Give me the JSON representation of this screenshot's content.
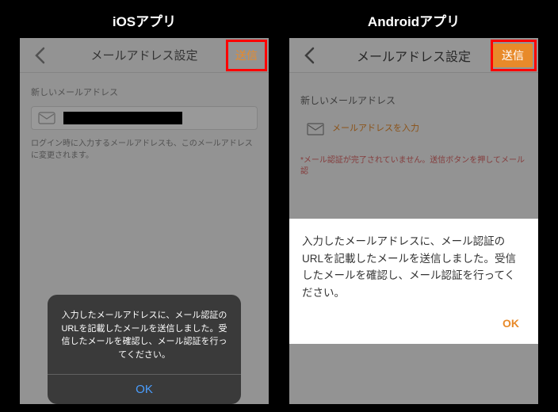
{
  "ios": {
    "label": "iOSアプリ",
    "header_title": "メールアドレス設定",
    "send_label": "送信",
    "field_label": "新しいメールアドレス",
    "helper": "ログイン時に入力するメールアドレスも、このメールアドレスに変更されます。",
    "dialog_text": "入力したメールアドレスに、メール認証のURLを記載したメールを送信しました。受信したメールを確認し、メール認証を行ってください。",
    "dialog_ok": "OK"
  },
  "android": {
    "label": "Androidアプリ",
    "header_title": "メールアドレス設定",
    "send_label": "送信",
    "field_label": "新しいメールアドレス",
    "placeholder": "メールアドレスを入力",
    "warning": "*メール認証が完了されていません。送信ボタンを押してメール認",
    "dialog_text": "入力したメールアドレスに、メール認証のURLを記載したメールを送信しました。受信したメールを確認し、メール認証を行ってください。",
    "dialog_ok": "OK"
  }
}
